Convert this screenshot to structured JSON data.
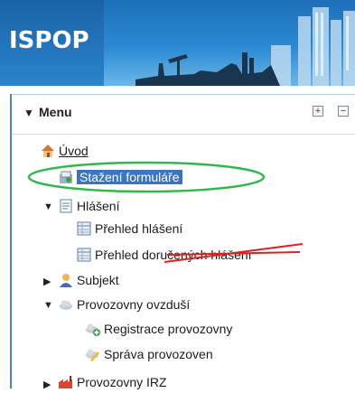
{
  "app": {
    "logo_text": "ISPOP"
  },
  "panel": {
    "title": "Menu",
    "expand_icon": "expand-all-icon",
    "collapse_icon": "collapse-all-icon"
  },
  "tree": {
    "uvod": "Úvod",
    "stazeni": "Stažení formuláře",
    "hlaseni": "Hlášení",
    "prehled_hlaseni": "Přehled hlášení",
    "prehled_dorucenych": "Přehled doručených hlášení",
    "subjekt": "Subjekt",
    "provozovny_ovzdusi": "Provozovny ovzduší",
    "registrace": "Registrace provozovny",
    "sprava": "Správa provozoven",
    "provozovny_irz": "Provozovny IRZ"
  },
  "colors": {
    "banner": "#2a8ad3",
    "selection": "#3c74c4",
    "annotation_green": "#2fb84a",
    "strike_red": "#e0201c"
  }
}
